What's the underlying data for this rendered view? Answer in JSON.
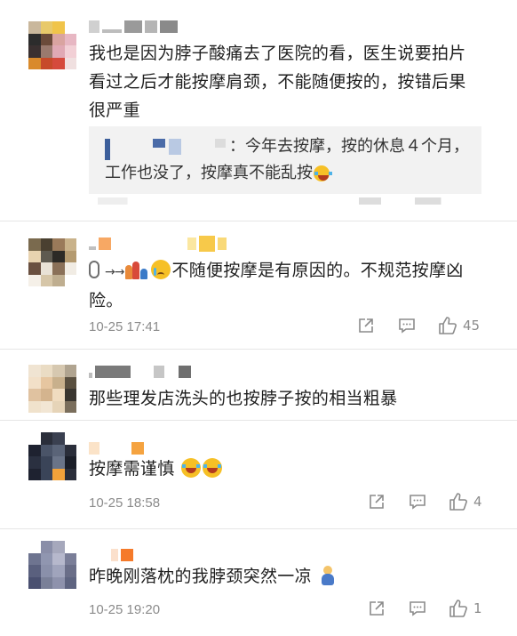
{
  "comments": [
    {
      "text": "我也是因为脖子酸痛去了医院的看，医生说要拍片看过之后才能按摩肩颈，不能随便按的，按错后果很严重",
      "quote": {
        "text": "：今年去按摩，按的休息４个月，工作也没了，按摩真不能乱按"
      }
    },
    {
      "prefix_arrow": "→→",
      "text": "不随便按摩是有原因的。不规范按摩凶险。",
      "time": "10-25 17:41",
      "like_count": "45"
    },
    {
      "text": "那些理发店洗头的也按脖子按的相当粗暴"
    },
    {
      "text": "按摩需谨慎",
      "time": "10-25 18:58",
      "like_count": "4"
    },
    {
      "text": "昨晚刚落枕的我脖颈突然一凉",
      "time": "10-25 19:20",
      "like_count": "1"
    }
  ],
  "icons": {
    "share": "share-icon",
    "reply": "comment-icon",
    "like": "thumbs-up-icon",
    "laugh": "laughing-tears-emoji",
    "cry": "crying-emoji",
    "mic": "microphone-icon"
  },
  "colors": {
    "text": "#1f1f1f",
    "meta": "#8b8b8b",
    "quote_bg": "#f2f2f2",
    "divider": "#e6e6e6"
  }
}
